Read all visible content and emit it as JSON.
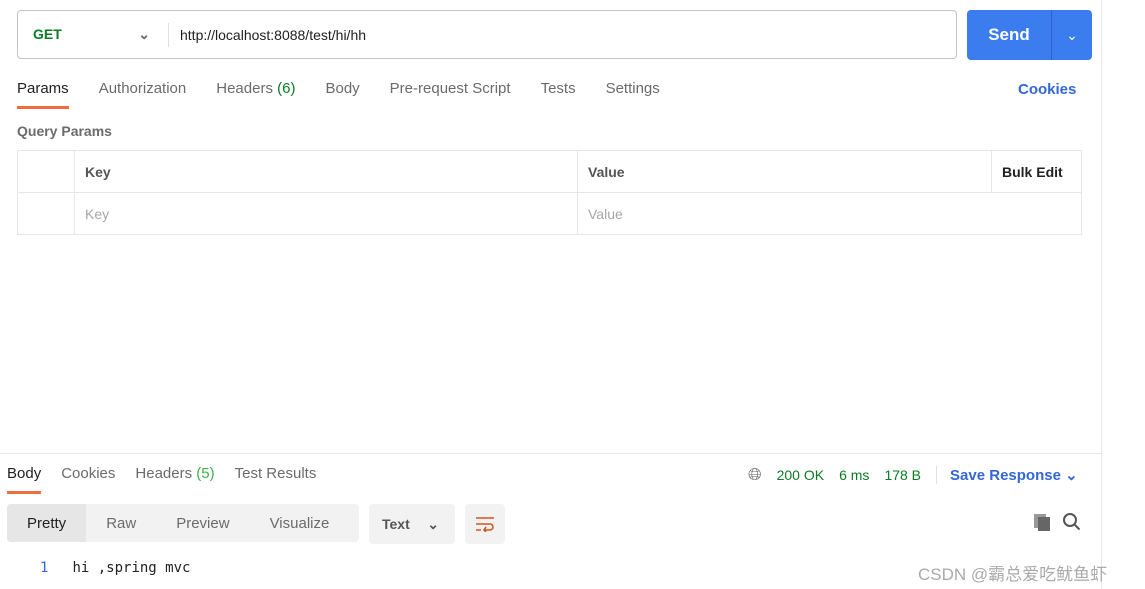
{
  "request": {
    "method": "GET",
    "url": "http://localhost:8088/test/hi/hh",
    "send_label": "Send"
  },
  "request_tabs": [
    {
      "label": "Params"
    },
    {
      "label": "Authorization"
    },
    {
      "label": "Headers",
      "count": "(6)"
    },
    {
      "label": "Body"
    },
    {
      "label": "Pre-request Script"
    },
    {
      "label": "Tests"
    },
    {
      "label": "Settings"
    }
  ],
  "cookies_label": "Cookies",
  "query_params": {
    "title": "Query Params",
    "headers": {
      "key": "Key",
      "value": "Value",
      "bulk": "Bulk Edit"
    },
    "placeholders": {
      "key": "Key",
      "value": "Value"
    }
  },
  "response_tabs": [
    {
      "label": "Body"
    },
    {
      "label": "Cookies"
    },
    {
      "label": "Headers",
      "count": "(5)"
    },
    {
      "label": "Test Results"
    }
  ],
  "status": {
    "code": "200 OK",
    "time": "6 ms",
    "size": "178 B",
    "save": "Save Response"
  },
  "view_modes": [
    "Pretty",
    "Raw",
    "Preview",
    "Visualize"
  ],
  "format": "Text",
  "body_lines": [
    {
      "n": "1",
      "text": "hi ,spring mvc"
    }
  ],
  "watermark": "CSDN @霸总爱吃鱿鱼虾",
  "colors": {
    "accent": "#3b7cef",
    "tab_underline": "#f26b3a",
    "method": "#0b7a25"
  }
}
